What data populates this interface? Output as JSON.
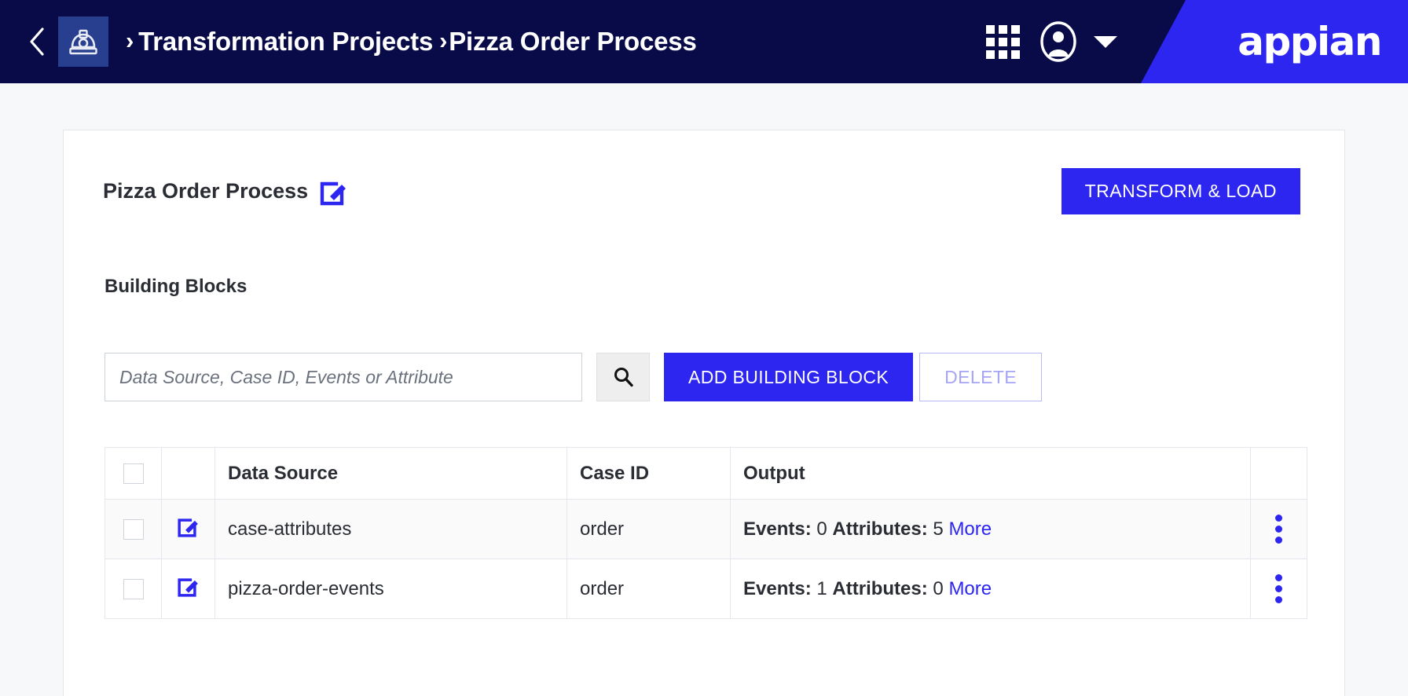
{
  "header": {
    "back_icon": "chevron-left-icon",
    "app_icon": "hard-hat-icon",
    "separator": "›",
    "breadcrumb": [
      {
        "label": "Transformation Projects"
      },
      {
        "label": "Pizza Order Process"
      }
    ],
    "apps_icon": "grid-apps-icon",
    "user_icon": "user-avatar-icon",
    "caret_icon": "chevron-down-icon",
    "logo": "appian",
    "colors": {
      "navy": "#080b47",
      "accent_blue": "#2d26f0",
      "tile_navy": "#283f8f"
    }
  },
  "card": {
    "title": "Pizza Order Process",
    "title_edit_icon": "edit-pencil-icon",
    "transform_load_label": "TRANSFORM & LOAD",
    "section_title": "Building Blocks"
  },
  "toolbar": {
    "search_placeholder": "Data Source, Case ID, Events or Attribute",
    "search_value": "",
    "search_icon": "search-icon",
    "add_label": "ADD BUILDING BLOCK",
    "delete_label": "DELETE"
  },
  "table": {
    "columns": [
      "",
      "",
      "Data Source",
      "Case ID",
      "Output",
      ""
    ],
    "headers": {
      "data_source": "Data Source",
      "case_id": "Case ID",
      "output": "Output"
    },
    "labels": {
      "events": "Events:",
      "attributes": "Attributes:",
      "more": "More"
    },
    "rows": [
      {
        "selected": false,
        "edit_icon": "edit-pencil-icon",
        "data_source": "case-attributes",
        "case_id": "order",
        "events": "0",
        "attributes": "5",
        "menu_icon": "kebab-menu-icon"
      },
      {
        "selected": false,
        "edit_icon": "edit-pencil-icon",
        "data_source": "pizza-order-events",
        "case_id": "order",
        "events": "1",
        "attributes": "0",
        "menu_icon": "kebab-menu-icon"
      }
    ]
  }
}
